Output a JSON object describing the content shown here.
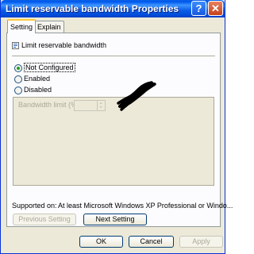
{
  "window": {
    "title": "Limit reservable bandwidth Properties",
    "help_button": "?",
    "close_button": "✕"
  },
  "tabs": [
    {
      "label": "Setting",
      "active": true
    },
    {
      "label": "Explain",
      "active": false
    }
  ],
  "policy": {
    "name": "Limit reservable bandwidth",
    "icon": "policy-setting-icon"
  },
  "radios": [
    {
      "label": "Not Configured",
      "checked": true
    },
    {
      "label": "Enabled",
      "checked": false
    },
    {
      "label": "Disabled",
      "checked": false
    }
  ],
  "options": {
    "bandwidth_label": "Bandwidth limit (%):",
    "bandwidth_value": ""
  },
  "supported": {
    "label": "Supported on:",
    "value": "At least Microsoft Windows XP Professional or Windo..."
  },
  "nav": {
    "previous": "Previous Setting",
    "next": "Next Setting"
  },
  "footer": {
    "ok": "OK",
    "cancel": "Cancel",
    "apply": "Apply"
  }
}
